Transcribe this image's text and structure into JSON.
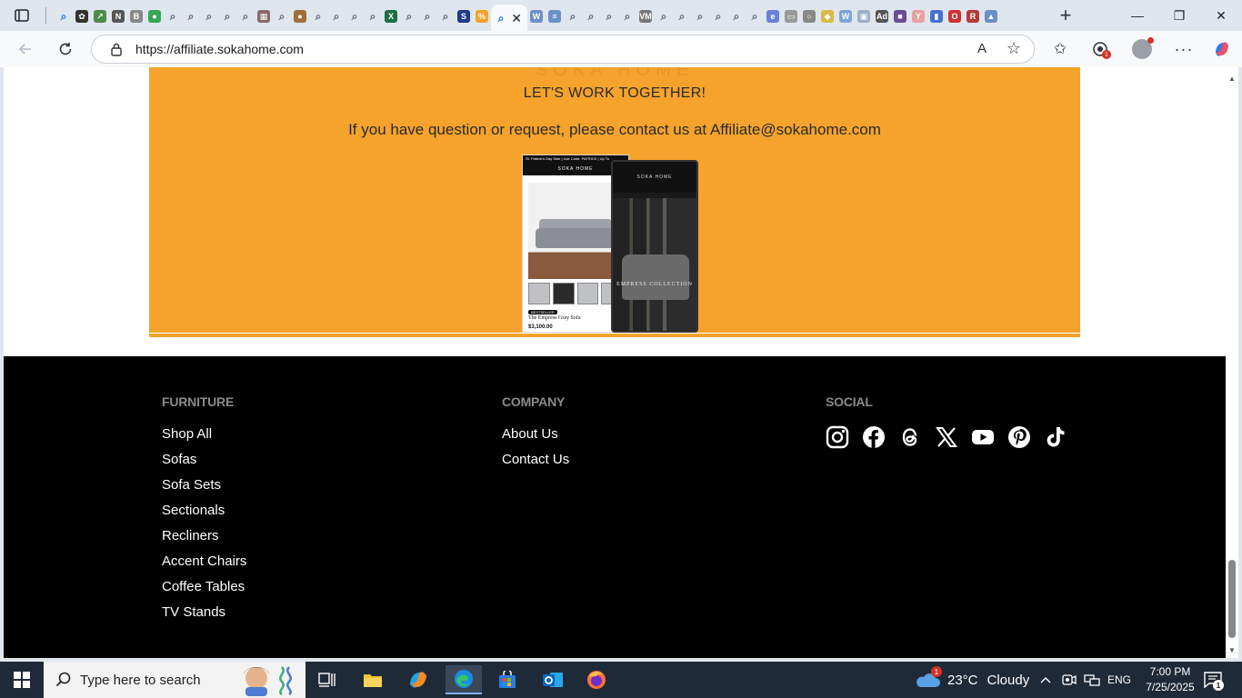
{
  "browser": {
    "url": "https://affiliate.sokahome.com",
    "tab_close_glyph": "✕",
    "new_tab_glyph": "+",
    "window_buttons": {
      "minimize": "—",
      "maximize": "❐",
      "close": "✕"
    },
    "toolbar_icons": {
      "read_aloud": "A",
      "favorite": "☆",
      "favorites_list": "✩",
      "more": "···"
    },
    "tabs": [
      {
        "icon": "search-icon",
        "color": "#1a73e8"
      },
      {
        "icon": "openai-icon",
        "color": "#333333"
      },
      {
        "icon": "chart-icon",
        "color": "#4c8c4a"
      },
      {
        "icon": "notion-icon",
        "color": "#555555"
      },
      {
        "icon": "book-icon",
        "color": "#888888"
      },
      {
        "icon": "chrome-icon",
        "color": "#34a853"
      },
      {
        "icon": "search-icon",
        "color": "#5b6a7a"
      },
      {
        "icon": "search-icon",
        "color": "#5b6a7a"
      },
      {
        "icon": "search-icon",
        "color": "#5b6a7a"
      },
      {
        "icon": "search-icon",
        "color": "#5b6a7a"
      },
      {
        "icon": "search-icon",
        "color": "#5b6a7a"
      },
      {
        "icon": "image-icon",
        "color": "#8a6a6a"
      },
      {
        "icon": "search-icon",
        "color": "#5b6a7a"
      },
      {
        "icon": "cookie-icon",
        "color": "#a0703a"
      },
      {
        "icon": "search-icon",
        "color": "#5b6a7a"
      },
      {
        "icon": "search-icon",
        "color": "#5b6a7a"
      },
      {
        "icon": "search-icon",
        "color": "#5b6a7a"
      },
      {
        "icon": "search-icon",
        "color": "#5b6a7a"
      },
      {
        "icon": "excel-icon",
        "color": "#1d6f42"
      },
      {
        "icon": "search-icon",
        "color": "#5b6a7a"
      },
      {
        "icon": "search-icon",
        "color": "#5b6a7a"
      },
      {
        "icon": "search-icon",
        "color": "#5b6a7a"
      },
      {
        "icon": "s-icon",
        "color": "#1e3a8a"
      },
      {
        "icon": "sale-icon",
        "color": "#f5a32c"
      },
      {
        "icon": "word-icon",
        "color": "#6b8fc7"
      },
      {
        "icon": "doc-icon",
        "color": "#6b8fc7"
      },
      {
        "icon": "search-icon",
        "color": "#5b6a7a"
      },
      {
        "icon": "search-icon",
        "color": "#5b6a7a"
      },
      {
        "icon": "search-icon",
        "color": "#5b6a7a"
      },
      {
        "icon": "search-icon",
        "color": "#5b6a7a"
      },
      {
        "icon": "vm-icon",
        "color": "#777777"
      },
      {
        "icon": "search-icon",
        "color": "#5b6a7a"
      },
      {
        "icon": "search-icon",
        "color": "#5b6a7a"
      },
      {
        "icon": "search-icon",
        "color": "#5b6a7a"
      },
      {
        "icon": "search-icon",
        "color": "#5b6a7a"
      },
      {
        "icon": "search-icon",
        "color": "#5b6a7a"
      },
      {
        "icon": "search-icon",
        "color": "#5b6a7a"
      },
      {
        "icon": "edge-icon",
        "color": "#6a7fd8"
      },
      {
        "icon": "app-icon",
        "color": "#999999"
      },
      {
        "icon": "circle-icon",
        "color": "#888888"
      },
      {
        "icon": "map-icon",
        "color": "#d9b94a"
      },
      {
        "icon": "word-icon",
        "color": "#7ea4d8"
      },
      {
        "icon": "photo-icon",
        "color": "#9ab0c7"
      },
      {
        "icon": "ad-icon",
        "color": "#555555"
      },
      {
        "icon": "purple-icon",
        "color": "#6a4c93"
      },
      {
        "icon": "y-icon",
        "color": "#e8a0a0"
      },
      {
        "icon": "bars-icon",
        "color": "#4a6fd1"
      },
      {
        "icon": "opera-icon",
        "color": "#cc3333"
      },
      {
        "icon": "r-icon",
        "color": "#b33a3a"
      },
      {
        "icon": "drive-icon",
        "color": "#6b8fc7"
      }
    ]
  },
  "page": {
    "cut_heading": "SOKA HOME",
    "lets_work": "LET'S WORK TOGETHER!",
    "contact_line": "If you have question or request, please contact us at Affiliate@sokahome.com",
    "mockup": {
      "promo_bar": "St. Patrick's Day Sale | Use Code: PATRICK | Up To",
      "logo": "SOKA HOME",
      "best_seller": "BESTSELLER",
      "product_name": "The Empress Gray Sofa",
      "price": "$3,100.00",
      "phone_url": "sokahome.com",
      "collection": "EMPRESS COLLECTION"
    },
    "colors": {
      "accent": "#f5a32c",
      "footer_bg": "#000000"
    }
  },
  "footer": {
    "furniture": {
      "title": "FURNITURE",
      "links": [
        "Shop All",
        "Sofas",
        "Sofa Sets",
        "Sectionals",
        "Recliners",
        "Accent Chairs",
        "Coffee Tables",
        "TV Stands"
      ]
    },
    "company": {
      "title": "COMPANY",
      "links": [
        "About Us",
        "Contact Us"
      ]
    },
    "social": {
      "title": "SOCIAL",
      "icons": [
        "instagram-icon",
        "facebook-icon",
        "threads-icon",
        "x-icon",
        "youtube-icon",
        "pinterest-icon",
        "tiktok-icon"
      ]
    }
  },
  "taskbar": {
    "search_placeholder": "Type here to search",
    "weather_badge": "1",
    "temperature": "23°C",
    "condition": "Cloudy",
    "language": "ENG",
    "time": "7:00 PM",
    "date": "7/25/2025",
    "notification_count": "1"
  }
}
